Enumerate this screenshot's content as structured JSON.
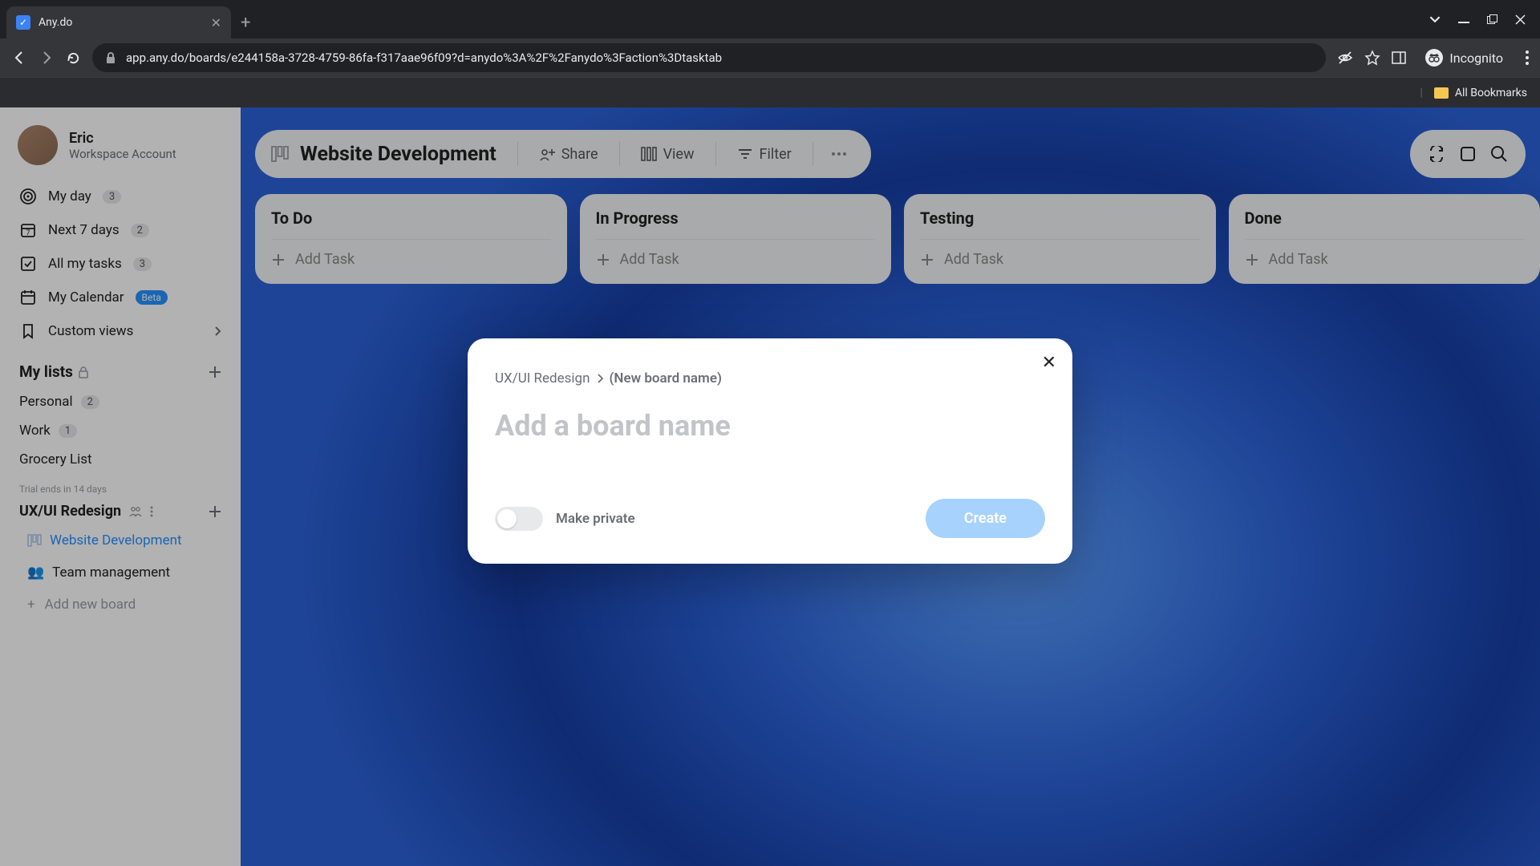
{
  "browser": {
    "tab_title": "Any.do",
    "url": "app.any.do/boards/e244158a-3728-4759-86fa-f317aae96f09?d=anydo%3A%2F%2Fanydo%3Faction%3Dtasktab",
    "incognito_label": "Incognito",
    "bookmarks_label": "All Bookmarks"
  },
  "user": {
    "name": "Eric",
    "subtitle": "Workspace Account"
  },
  "sidebar": {
    "items": [
      {
        "label": "My day",
        "count": "3"
      },
      {
        "label": "Next 7 days",
        "count": "2"
      },
      {
        "label": "All my tasks",
        "count": "3"
      },
      {
        "label": "My Calendar",
        "badge": "Beta"
      },
      {
        "label": "Custom views"
      }
    ],
    "my_lists_header": "My lists",
    "lists": [
      {
        "label": "Personal",
        "count": "2"
      },
      {
        "label": "Work",
        "count": "1"
      },
      {
        "label": "Grocery List"
      }
    ],
    "trial_text": "Trial ends in 14 days",
    "group": {
      "name": "UX/UI Redesign",
      "boards": [
        {
          "label": "Website Development",
          "active": true,
          "emoji": ""
        },
        {
          "label": "Team management",
          "emoji": "👥"
        }
      ],
      "add_label": "Add new board"
    }
  },
  "toolbar": {
    "title": "Website Development",
    "share": "Share",
    "view": "View",
    "filter": "Filter"
  },
  "columns": [
    {
      "title": "To Do",
      "add": "Add Task"
    },
    {
      "title": "In Progress",
      "add": "Add Task"
    },
    {
      "title": "Testing",
      "add": "Add Task"
    },
    {
      "title": "Done",
      "add": "Add Task"
    }
  ],
  "modal": {
    "breadcrumb_parent": "UX/UI Redesign",
    "breadcrumb_current": "(New board name)",
    "placeholder": "Add a board name",
    "toggle_label": "Make private",
    "create_label": "Create"
  }
}
